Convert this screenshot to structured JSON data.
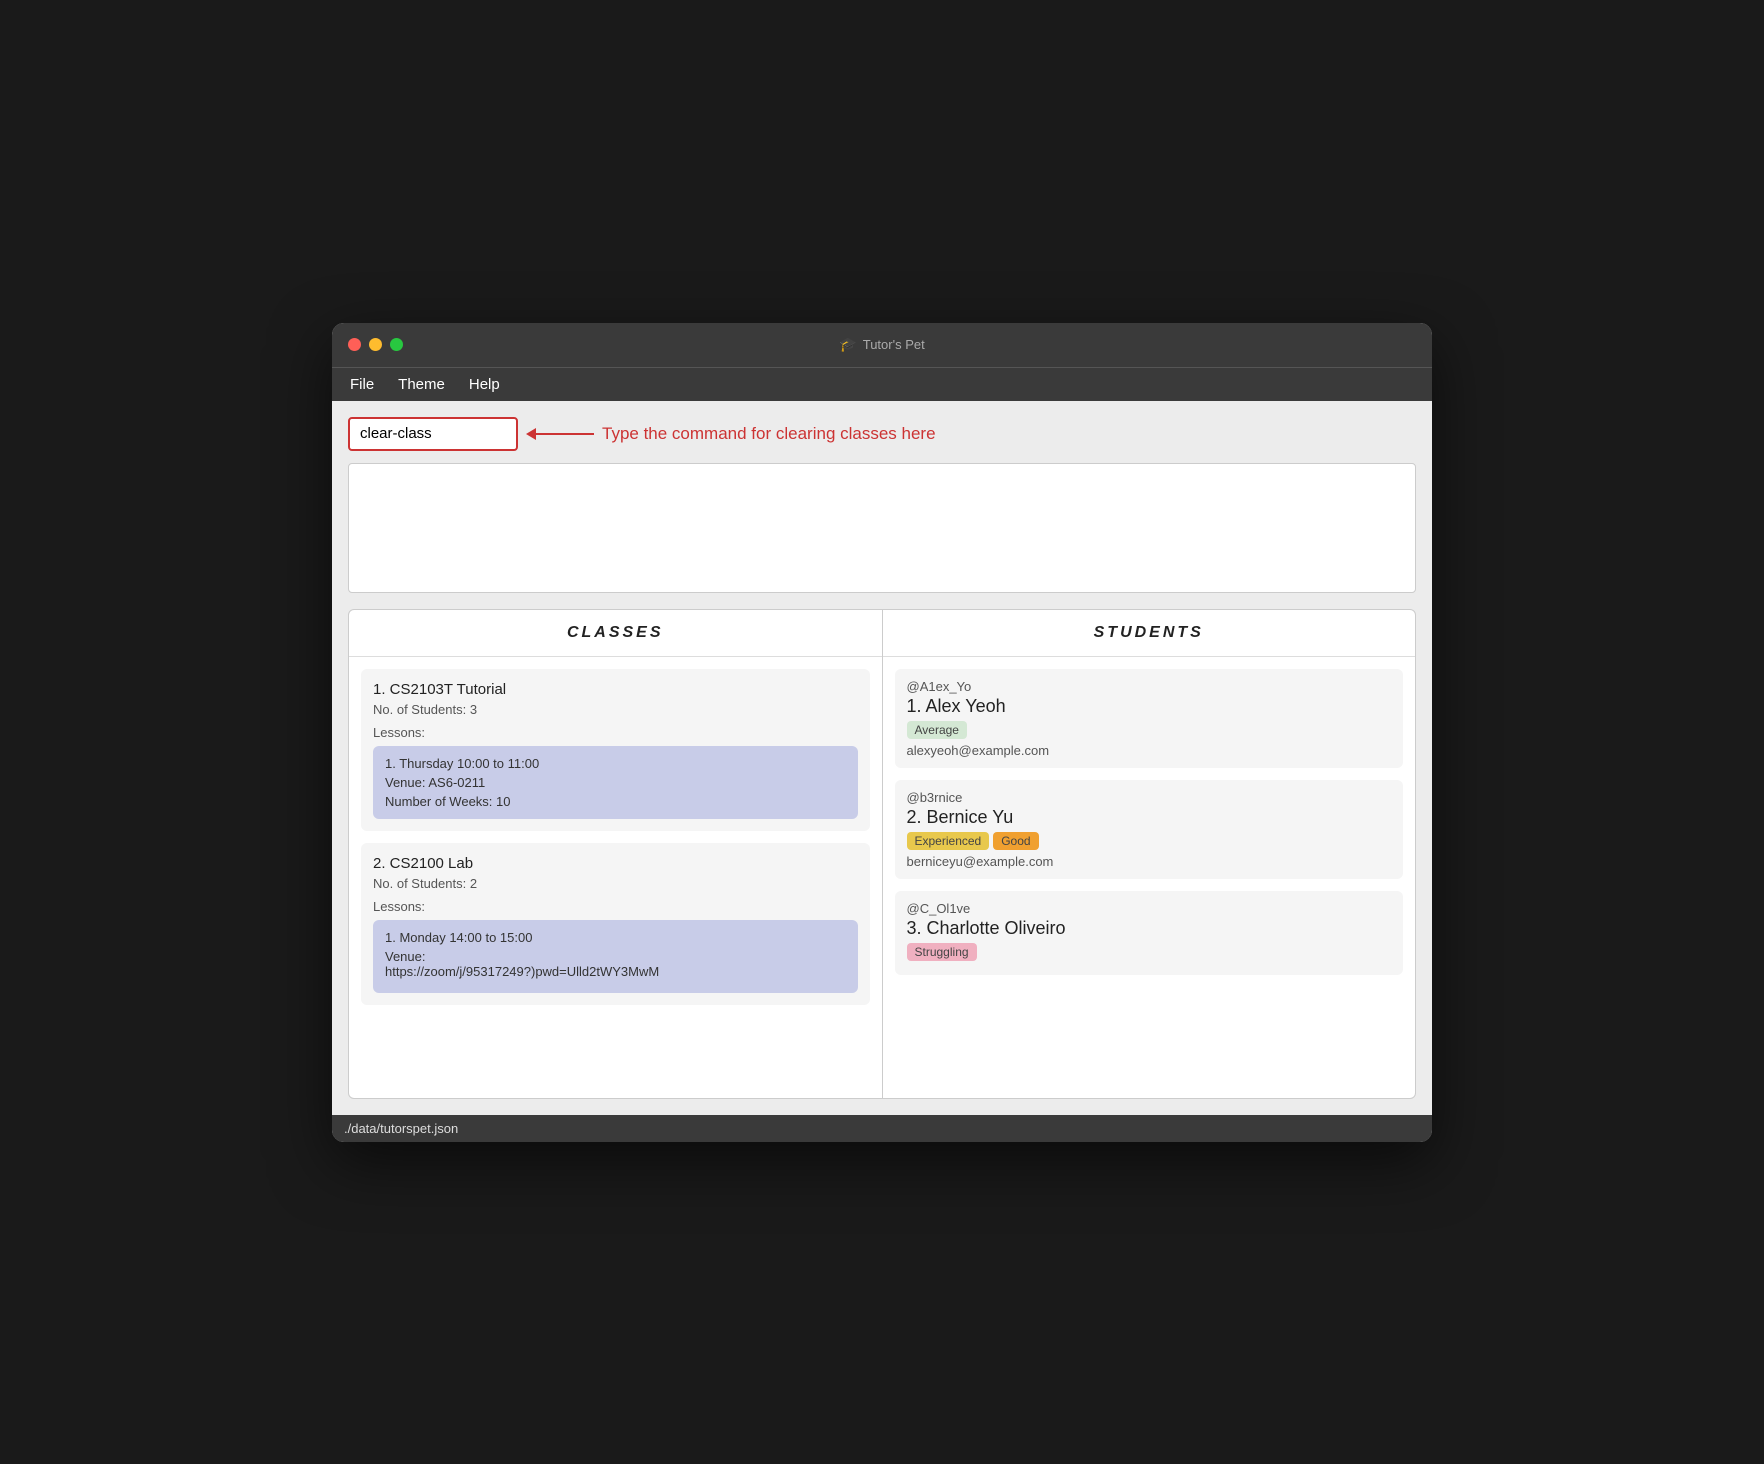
{
  "window": {
    "title": "Tutor's Pet",
    "controls": {
      "close": "close",
      "minimize": "minimize",
      "maximize": "maximize"
    }
  },
  "menu": {
    "items": [
      "File",
      "Theme",
      "Help"
    ]
  },
  "command": {
    "input_value": "clear-class",
    "hint_text": "Type the command for clearing classes here"
  },
  "output": {
    "content": ""
  },
  "classes_panel": {
    "header": "CLASSES",
    "items": [
      {
        "number": 1,
        "title": "CS2103T Tutorial",
        "students_label": "No. of Students:",
        "students_count": "3",
        "lessons_label": "Lessons:",
        "lessons": [
          {
            "number": 1,
            "time": "Thursday 10:00 to 11:00",
            "venue_label": "Venue:",
            "venue": "AS6-0211",
            "weeks_label": "Number of Weeks:",
            "weeks": "10"
          }
        ]
      },
      {
        "number": 2,
        "title": "CS2100 Lab",
        "students_label": "No. of Students:",
        "students_count": "2",
        "lessons_label": "Lessons:",
        "lessons": [
          {
            "number": 1,
            "time": "Monday 14:00 to 15:00",
            "venue_label": "Venue:",
            "venue": "https://zoom/j/95317249?)pwd=Ulld2tWY3MwM",
            "weeks_label": "",
            "weeks": ""
          }
        ]
      }
    ]
  },
  "students_panel": {
    "header": "STUDENTS",
    "items": [
      {
        "handle": "@A1ex_Yo",
        "number": 1,
        "name": "Alex Yeoh",
        "tags": [
          {
            "label": "Average",
            "type": "average"
          }
        ],
        "email": "alexyeoh@example.com"
      },
      {
        "handle": "@b3rnice",
        "number": 2,
        "name": "Bernice Yu",
        "tags": [
          {
            "label": "Experienced",
            "type": "experienced"
          },
          {
            "label": "Good",
            "type": "good"
          }
        ],
        "email": "berniceyu@example.com"
      },
      {
        "handle": "@C_Ol1ve",
        "number": 3,
        "name": "Charlotte Oliveiro",
        "tags": [
          {
            "label": "Struggling",
            "type": "struggling"
          }
        ],
        "email": ""
      }
    ]
  },
  "status_bar": {
    "path": "./data/tutorspet.json"
  }
}
